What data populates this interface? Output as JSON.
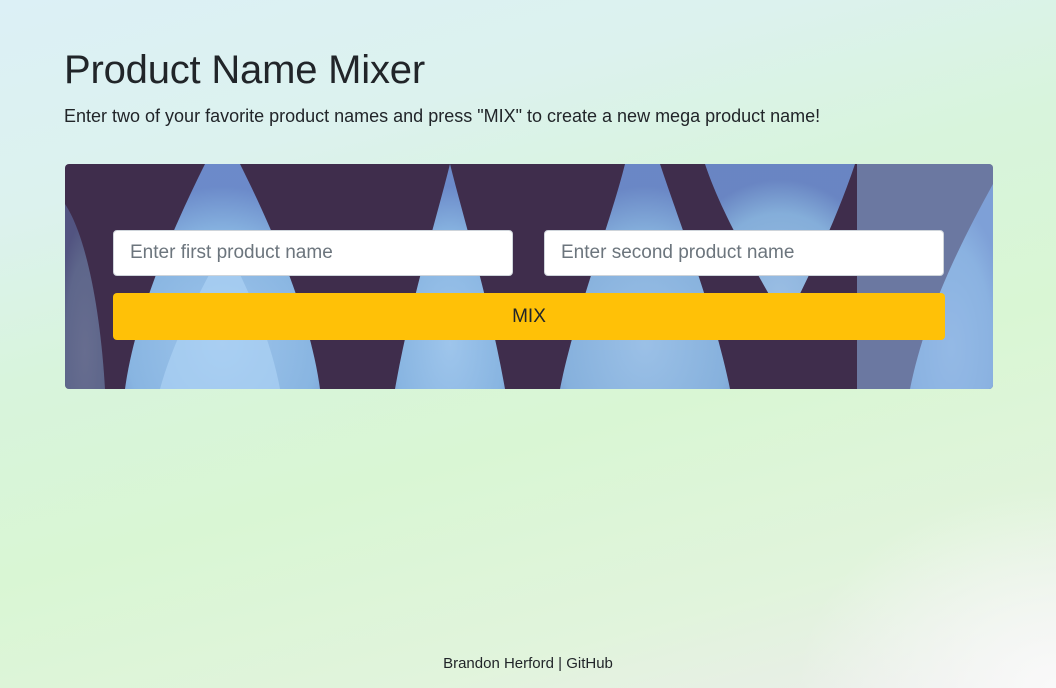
{
  "header": {
    "title": "Product Name Mixer",
    "subtitle": "Enter two of your favorite product names and press \"MIX\" to create a new mega product name!"
  },
  "mixer": {
    "first_input": {
      "value": "",
      "placeholder": "Enter first product name"
    },
    "second_input": {
      "value": "",
      "placeholder": "Enter second product name"
    },
    "mix_button_label": "MIX"
  },
  "footer": {
    "author": "Brandon Herford",
    "separator": " | ",
    "github_link": "GitHub"
  },
  "colors": {
    "panel_background": "#3f2d4c",
    "panel_art": "#92c1ee",
    "mix_button": "#ffc107",
    "text": "#212529"
  }
}
